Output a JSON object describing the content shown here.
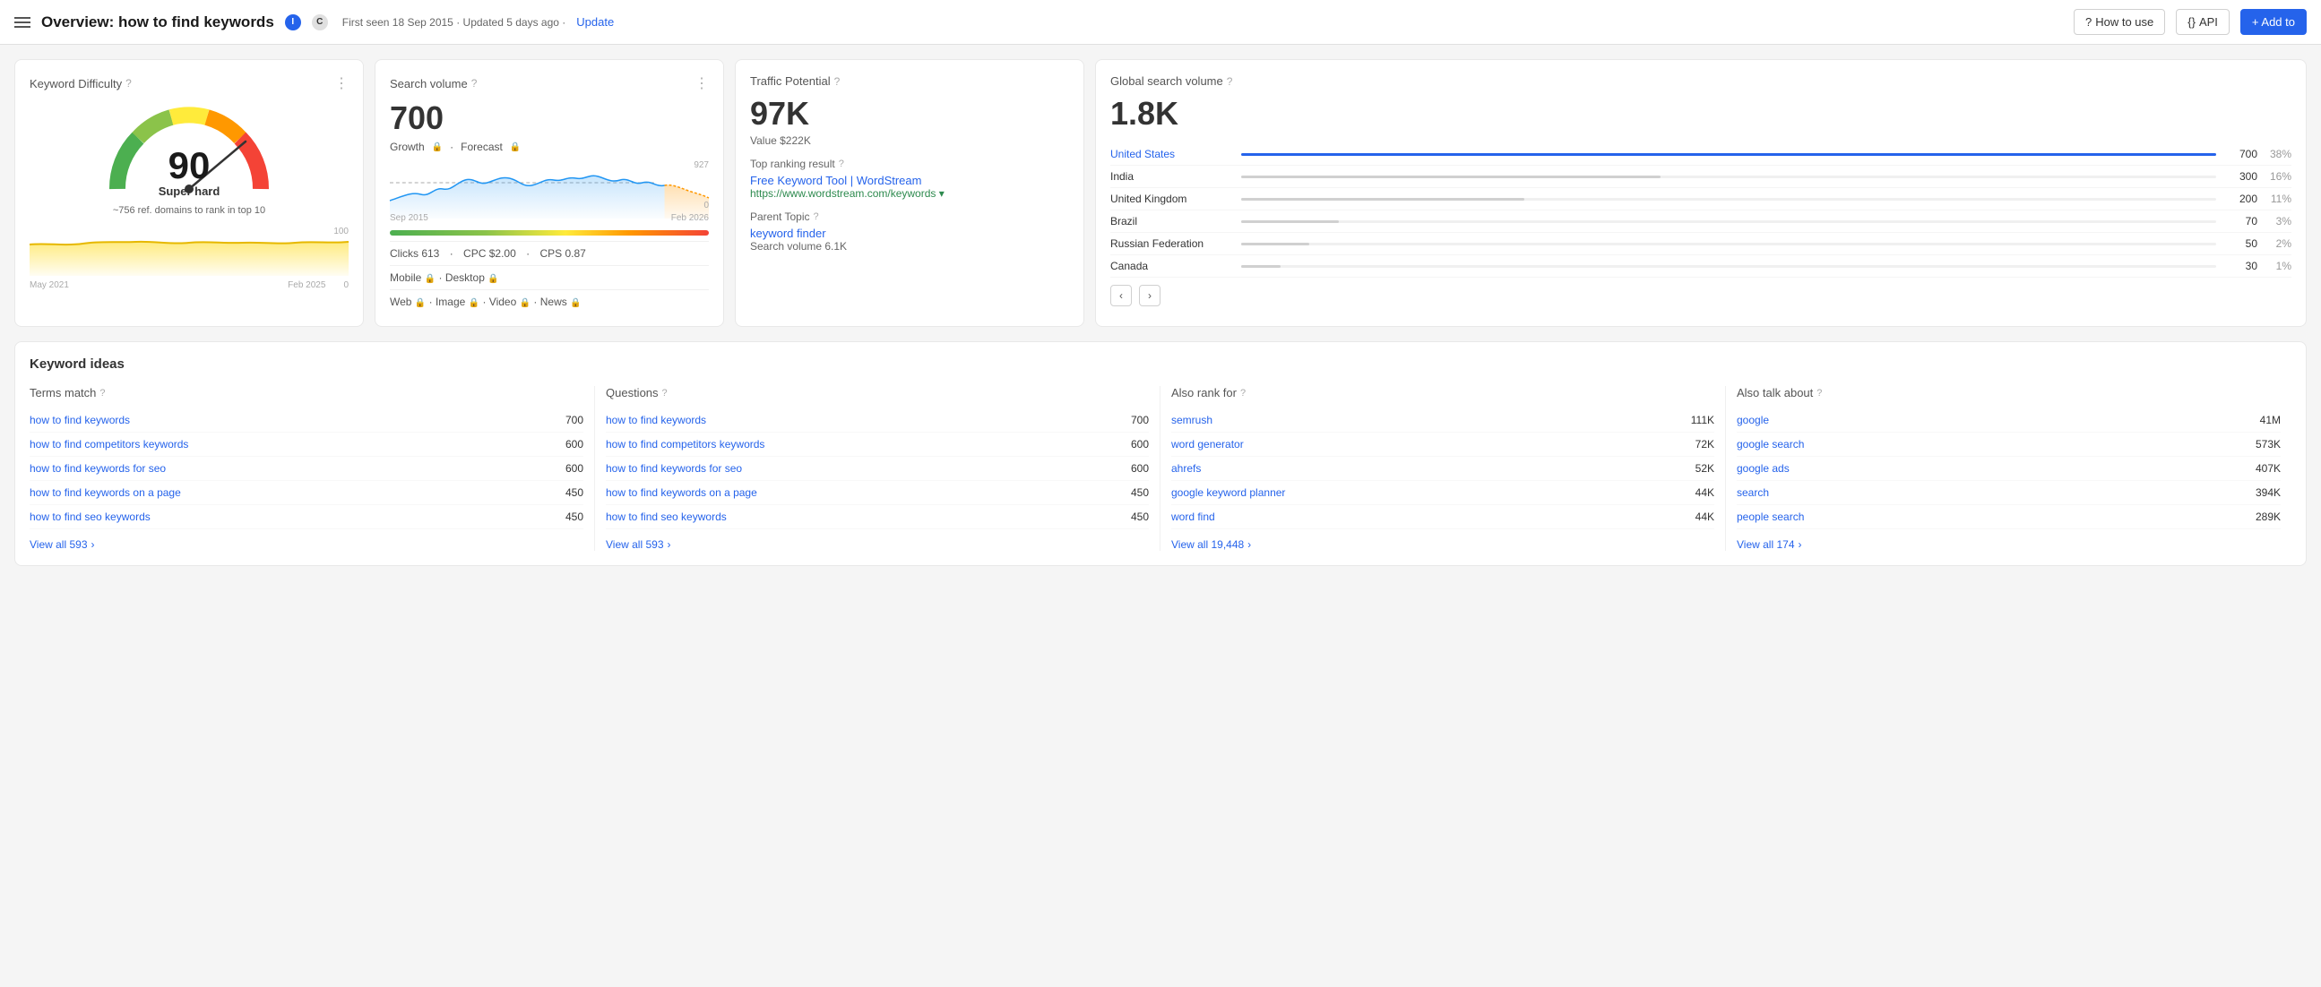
{
  "header": {
    "title": "Overview: how to find keywords",
    "badge_i": "I",
    "badge_c": "C",
    "meta": "First seen 18 Sep 2015 · Updated 5 days ago ·",
    "update_label": "Update",
    "how_to_use": "How to use",
    "api": "API",
    "add_to": "+ Add to"
  },
  "keyword_difficulty": {
    "title": "Keyword Difficulty",
    "value": "90",
    "label": "Super hard",
    "sublabel": "~756 ref. domains to rank in top 10",
    "date_start": "May 2021",
    "date_end": "Feb 2025",
    "chart_max": "100",
    "chart_min": "0"
  },
  "search_volume": {
    "title": "Search volume",
    "value": "700",
    "growth": "Growth",
    "forecast": "Forecast",
    "chart_high": "927",
    "chart_low": "0",
    "date_start": "Sep 2015",
    "date_end": "Feb 2026",
    "clicks": "Clicks 613",
    "cpc": "CPC $2.00",
    "cps": "CPS 0.87",
    "mobile": "Mobile",
    "desktop": "Desktop",
    "web": "Web",
    "image": "Image",
    "video": "Video",
    "news": "News"
  },
  "traffic_potential": {
    "title": "Traffic Potential",
    "value": "97K",
    "value_label": "Value $222K",
    "top_ranking_title": "Top ranking result",
    "top_result_name": "Free Keyword Tool | WordStream",
    "top_result_url": "https://www.wordstream.com/keywords",
    "parent_topic_title": "Parent Topic",
    "parent_topic_link": "keyword finder",
    "parent_topic_vol": "Search volume 6.1K"
  },
  "global_search_volume": {
    "title": "Global search volume",
    "value": "1.8K",
    "countries": [
      {
        "name": "United States",
        "count": "700",
        "pct": "38%",
        "bar_pct": 100,
        "active": true
      },
      {
        "name": "India",
        "count": "300",
        "pct": "16%",
        "bar_pct": 43,
        "active": false
      },
      {
        "name": "United Kingdom",
        "count": "200",
        "pct": "11%",
        "bar_pct": 29,
        "active": false
      },
      {
        "name": "Brazil",
        "count": "70",
        "pct": "3%",
        "bar_pct": 10,
        "active": false
      },
      {
        "name": "Russian Federation",
        "count": "50",
        "pct": "2%",
        "bar_pct": 7,
        "active": false
      },
      {
        "name": "Canada",
        "count": "30",
        "pct": "1%",
        "bar_pct": 4,
        "active": false
      }
    ]
  },
  "keyword_ideas": {
    "title": "Keyword ideas",
    "columns": [
      {
        "id": "terms_match",
        "header": "Terms match",
        "items": [
          {
            "label": "how to find keywords",
            "value": "700"
          },
          {
            "label": "how to find competitors keywords",
            "value": "600"
          },
          {
            "label": "how to find keywords for seo",
            "value": "600"
          },
          {
            "label": "how to find keywords on a page",
            "value": "450"
          },
          {
            "label": "how to find seo keywords",
            "value": "450"
          }
        ],
        "view_all": "View all 593",
        "view_all_count": "593"
      },
      {
        "id": "questions",
        "header": "Questions",
        "items": [
          {
            "label": "how to find keywords",
            "value": "700"
          },
          {
            "label": "how to find competitors keywords",
            "value": "600"
          },
          {
            "label": "how to find keywords for seo",
            "value": "600"
          },
          {
            "label": "how to find keywords on a page",
            "value": "450"
          },
          {
            "label": "how to find seo keywords",
            "value": "450"
          }
        ],
        "view_all": "View all 593",
        "view_all_count": "593"
      },
      {
        "id": "also_rank_for",
        "header": "Also rank for",
        "items": [
          {
            "label": "semrush",
            "value": "111K"
          },
          {
            "label": "word generator",
            "value": "72K"
          },
          {
            "label": "ahrefs",
            "value": "52K"
          },
          {
            "label": "google keyword planner",
            "value": "44K"
          },
          {
            "label": "word find",
            "value": "44K"
          }
        ],
        "view_all": "View all 19,448",
        "view_all_count": "19,448"
      },
      {
        "id": "also_talk_about",
        "header": "Also talk about",
        "items": [
          {
            "label": "google",
            "value": "41M"
          },
          {
            "label": "google search",
            "value": "573K"
          },
          {
            "label": "google ads",
            "value": "407K"
          },
          {
            "label": "search",
            "value": "394K"
          },
          {
            "label": "people search",
            "value": "289K"
          }
        ],
        "view_all": "View all 174",
        "view_all_count": "174"
      }
    ]
  }
}
